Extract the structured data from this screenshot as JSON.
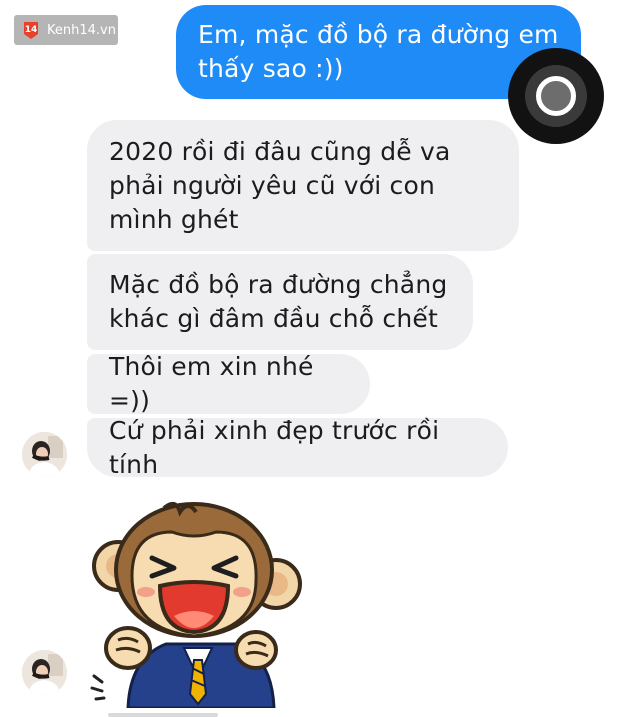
{
  "watermark": {
    "badge": "14",
    "text": "Kenh14.vn"
  },
  "messages": {
    "sent": [
      {
        "text": "Em, mặc đồ bộ ra đường em thấy sao :))"
      }
    ],
    "received": [
      {
        "text": "2020 rồi đi đâu cũng dễ va phải người yêu cũ với con mình ghét"
      },
      {
        "text": "Mặc đồ bộ ra đường chẳng khác gì đâm đầu chỗ chết"
      },
      {
        "text": "Thôi em xin nhé =))"
      },
      {
        "text": "Cứ phải xinh đẹp trước rồi tính"
      }
    ]
  },
  "sticker": {
    "icon": "laughing-monkey-sticker"
  },
  "colors": {
    "sent_bubble": "#1e8bf6",
    "received_bubble": "#efeff1",
    "watermark_accent": "#e8402a"
  }
}
